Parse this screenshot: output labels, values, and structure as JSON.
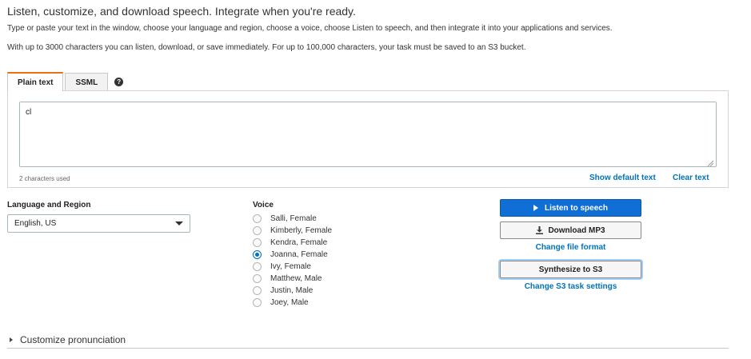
{
  "header": {
    "title": "Listen, customize, and download speech. Integrate when you're ready.",
    "description1": "Type or paste your text in the window, choose your language and region, choose a voice, choose Listen to speech, and then integrate it into your applications and services.",
    "description2": "With up to 3000 characters you can listen, download, or save immediately. For up to 100,000 characters, your task must be saved to an S3 bucket."
  },
  "tabs": [
    {
      "label": "Plain text",
      "active": true
    },
    {
      "label": "SSML",
      "active": false
    }
  ],
  "help_icon": {
    "glyph": "?",
    "icon": "question-circle-icon"
  },
  "editor": {
    "value": "cl",
    "char_count": "2 characters used",
    "show_default_label": "Show default text",
    "clear_label": "Clear text"
  },
  "language": {
    "label": "Language and Region",
    "selected": "English, US"
  },
  "voice": {
    "label": "Voice",
    "options": [
      {
        "label": "Salli, Female",
        "checked": false
      },
      {
        "label": "Kimberly, Female",
        "checked": false
      },
      {
        "label": "Kendra, Female",
        "checked": false
      },
      {
        "label": "Joanna, Female",
        "checked": true
      },
      {
        "label": "Ivy, Female",
        "checked": false
      },
      {
        "label": "Matthew, Male",
        "checked": false
      },
      {
        "label": "Justin, Male",
        "checked": false
      },
      {
        "label": "Joey, Male",
        "checked": false
      }
    ]
  },
  "actions": {
    "listen_label": "Listen to speech",
    "download_label": "Download MP3",
    "change_format_label": "Change file format",
    "s3_label": "Synthesize to S3",
    "change_s3_label": "Change S3 task settings"
  },
  "customize": {
    "label": "Customize pronunciation"
  },
  "colors": {
    "accent_blue": "#0073bb",
    "primary_button": "#0f6fd6",
    "tab_active_border": "#ec7211"
  }
}
